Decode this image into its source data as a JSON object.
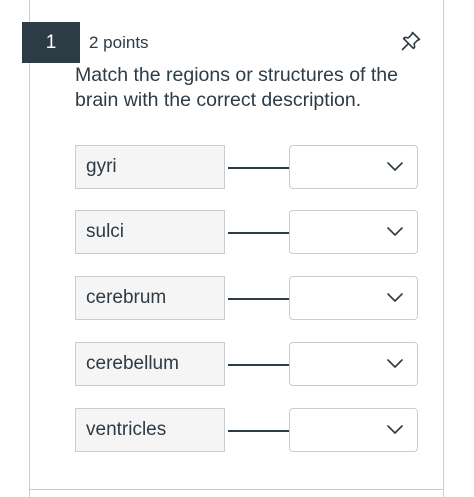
{
  "question": {
    "number": "1",
    "points": "2 points",
    "text": "Match the regions or structures of the brain with the correct description.",
    "pin_icon": "pin-icon"
  },
  "matches": [
    {
      "term": "gyri",
      "selected": ""
    },
    {
      "term": "sulci",
      "selected": ""
    },
    {
      "term": "cerebrum",
      "selected": ""
    },
    {
      "term": "cerebellum",
      "selected": ""
    },
    {
      "term": "ventricles",
      "selected": ""
    }
  ],
  "colors": {
    "text": "#2d3b45",
    "badge_bg": "#2d3b45",
    "term_bg": "#f5f5f5",
    "border": "#c7cdd1"
  }
}
